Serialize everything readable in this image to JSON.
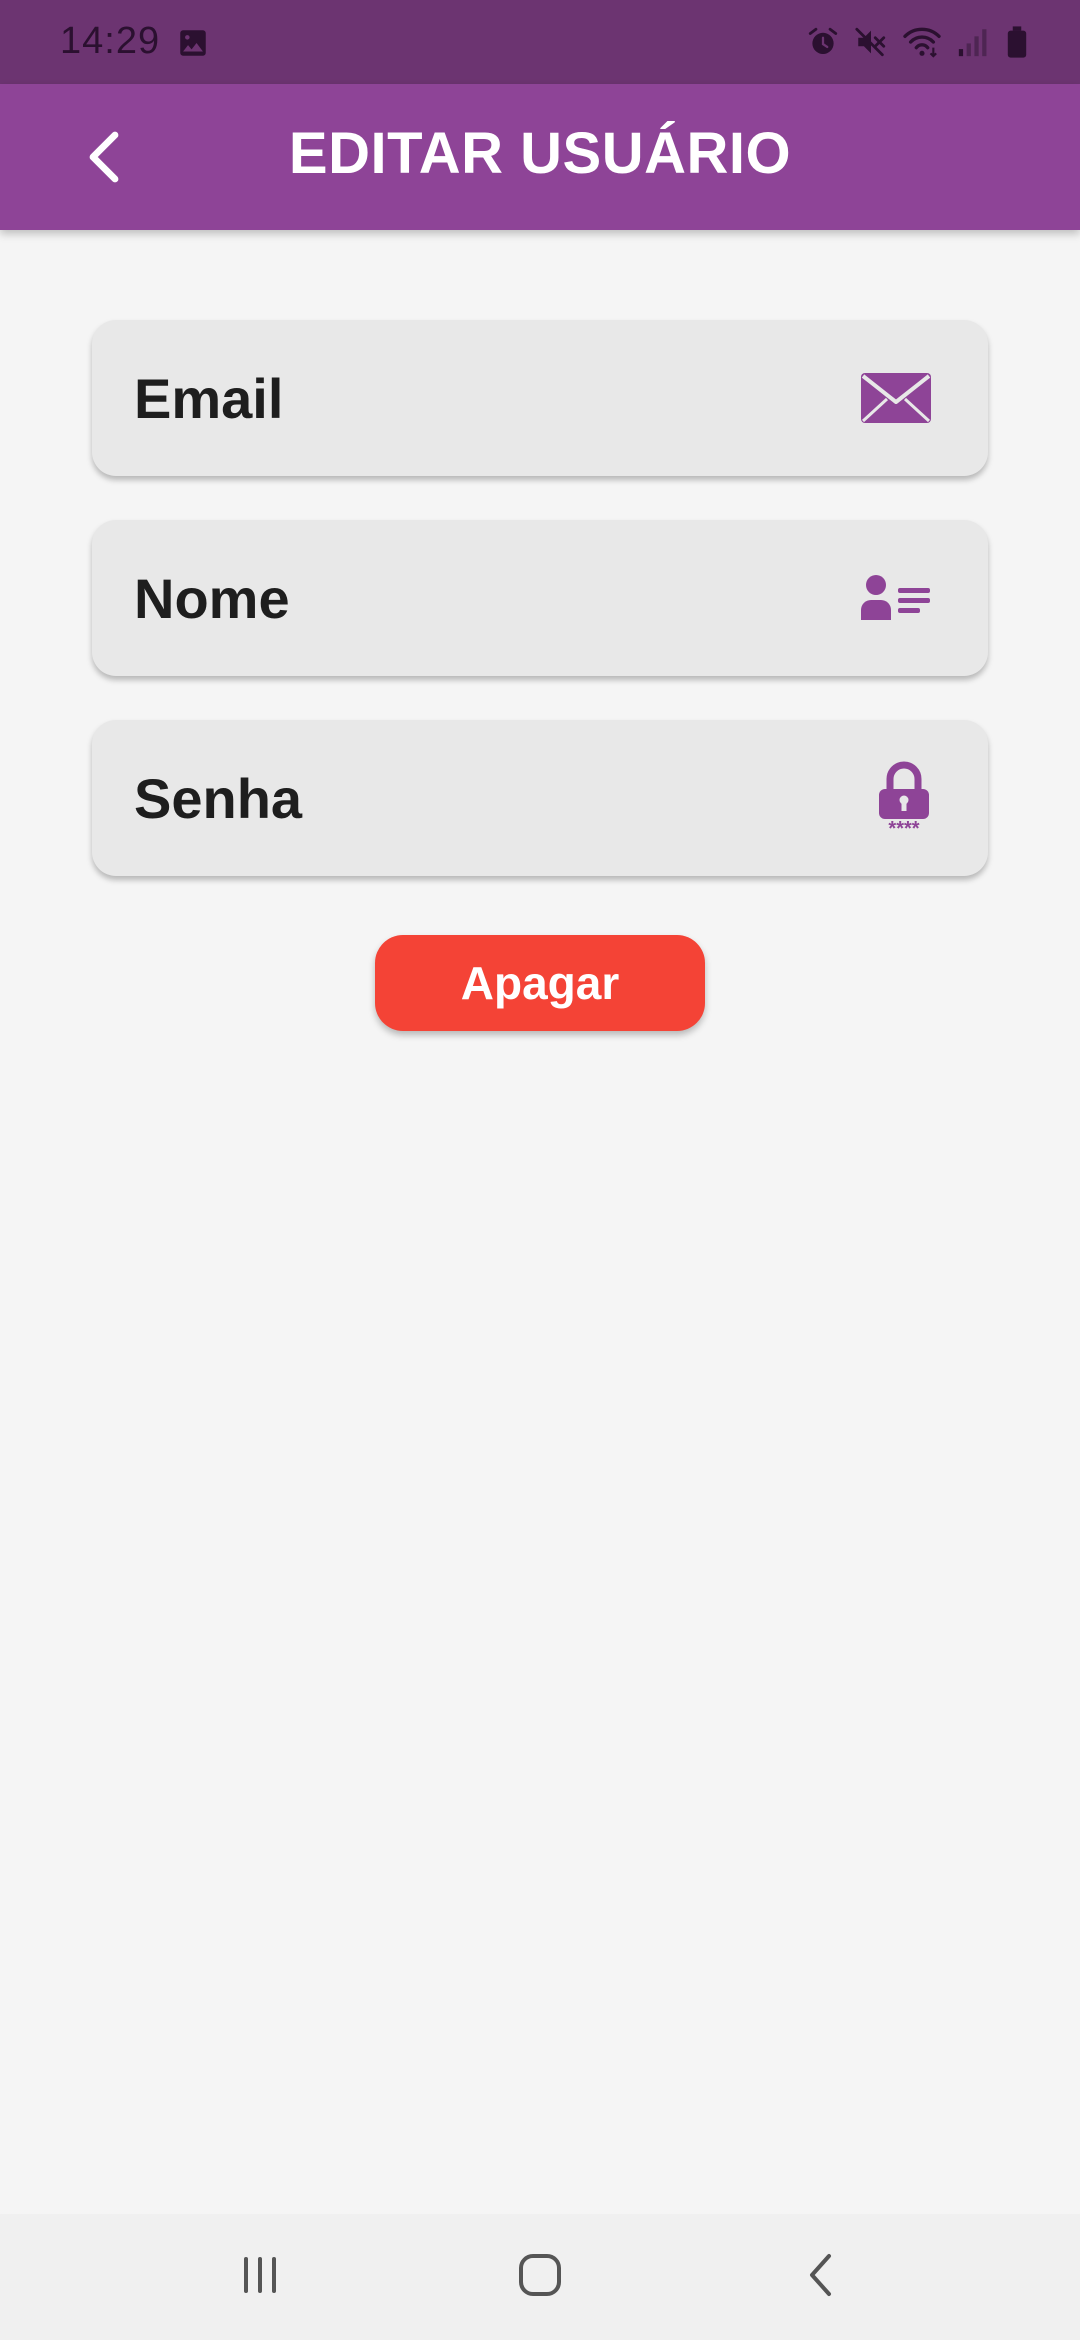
{
  "status_bar": {
    "time": "14:29",
    "icons": [
      "image-icon",
      "alarm-icon",
      "mute-icon",
      "wifi-icon",
      "signal-icon",
      "battery-icon"
    ]
  },
  "app_bar": {
    "title": "EDITAR USUÁRIO",
    "back_icon": "chevron-left-icon",
    "color": "#8e4497"
  },
  "form": {
    "email": {
      "placeholder": "Email",
      "value": "",
      "icon": "envelope-icon"
    },
    "name": {
      "placeholder": "Nome",
      "value": "",
      "icon": "contact-card-icon"
    },
    "password": {
      "placeholder": "Senha",
      "value": "",
      "icon": "lock-icon"
    }
  },
  "delete_button": {
    "label": "Apagar",
    "color": "#f44336"
  },
  "nav_bar": {
    "items": [
      "recent-apps-icon",
      "home-icon",
      "back-icon"
    ]
  },
  "colors": {
    "accent": "#8e4497",
    "status_bar": "#6c3471",
    "background": "#f5f5f5",
    "field": "#e8e8e8"
  }
}
